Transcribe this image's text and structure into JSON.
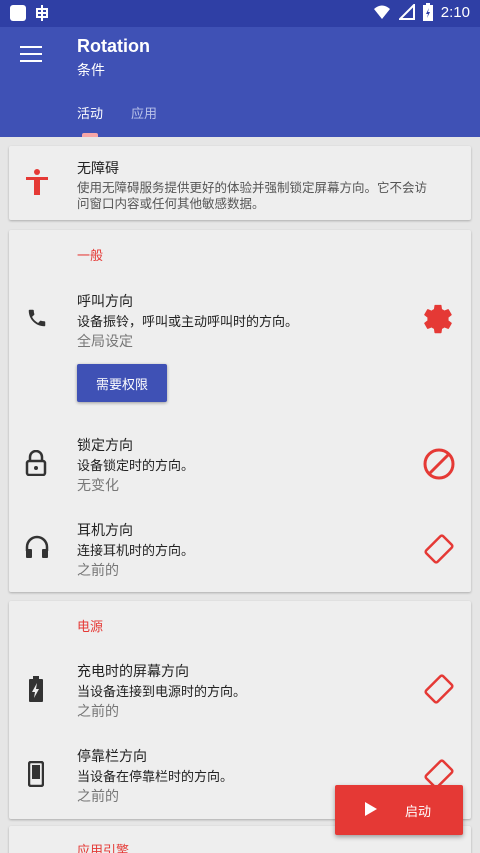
{
  "status_bar": {
    "time": "2:10",
    "notification_icon": "bug-icon"
  },
  "app": {
    "title": "Rotation",
    "subtitle": "条件"
  },
  "tabs": [
    {
      "label": "活动",
      "active": true
    },
    {
      "label": "应用",
      "active": false
    }
  ],
  "accessibility": {
    "title": "无障碍",
    "desc_line1": "使用无障碍服务提供更好的体验并强制锁定屏幕方向。它不会访",
    "desc_line2": "问窗口内容或任何其他敏感数据。",
    "icon": "accessibility-icon"
  },
  "general": {
    "header": "一般",
    "call": {
      "title": "呼叫方向",
      "desc": "设备振铃，呼叫或主动呼叫时的方向。",
      "value": "全局设定",
      "permission_button": "需要权限",
      "icon": "phone-icon",
      "action_icon": "gear-icon"
    },
    "lock": {
      "title": "锁定方向",
      "desc": "设备锁定时的方向。",
      "value": "无变化",
      "icon": "lock-icon",
      "action_icon": "block-icon"
    },
    "headset": {
      "title": "耳机方向",
      "desc": "连接耳机时的方向。",
      "value": "之前的",
      "icon": "headset-icon",
      "action_icon": "rotate-icon"
    }
  },
  "power": {
    "header": "电源",
    "charging": {
      "title": "充电时的屏幕方向",
      "desc": "当设备连接到电源时的方向。",
      "value": "之前的",
      "icon": "battery-charging-icon",
      "action_icon": "rotate-icon"
    },
    "dock": {
      "title": "停靠栏方向",
      "desc": "当设备在停靠栏时的方向。",
      "value": "之前的",
      "icon": "phone-device-icon",
      "action_icon": "rotate-icon"
    }
  },
  "engine": {
    "header": "应用引擎"
  },
  "fab": {
    "label": "启动",
    "icon": "play-icon"
  },
  "colors": {
    "primary": "#3f51b5",
    "primary_dark": "#2f3fa5",
    "accent": "#e53935"
  }
}
